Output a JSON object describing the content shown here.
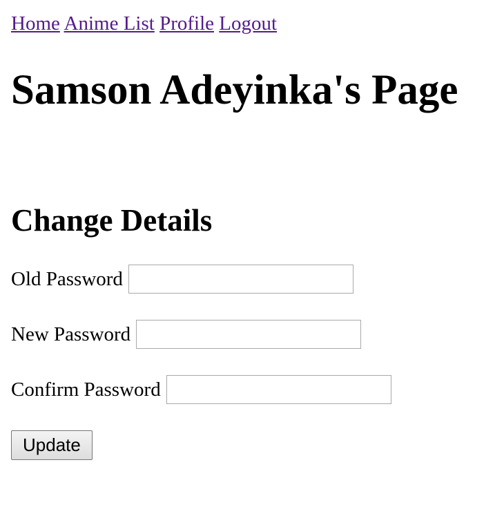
{
  "nav": {
    "home": "Home",
    "anime_list": "Anime List",
    "profile": "Profile",
    "logout": "Logout"
  },
  "page_title": "Samson Adeyinka's Page",
  "form": {
    "heading": "Change Details",
    "old_password": {
      "label": "Old Password",
      "value": ""
    },
    "new_password": {
      "label": "New Password",
      "value": ""
    },
    "confirm_password": {
      "label": "Confirm Password",
      "value": ""
    },
    "submit_label": "Update"
  },
  "colors": {
    "link": "#551a8b",
    "text": "#000000",
    "background": "#ffffff",
    "input_border": "#a9a9a9"
  }
}
